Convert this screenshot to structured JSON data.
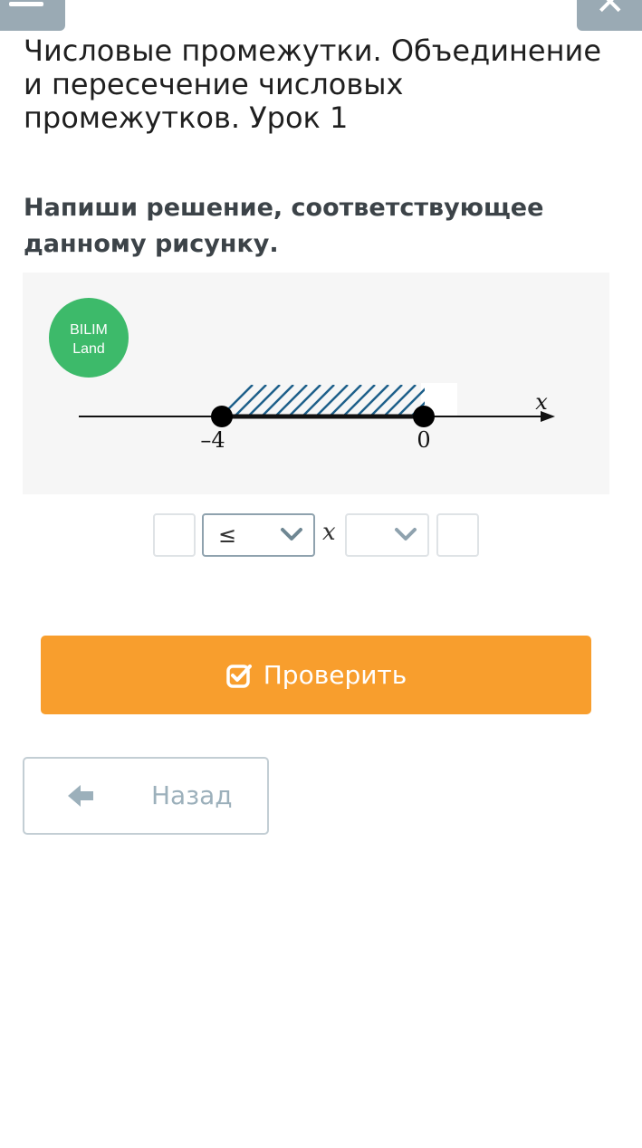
{
  "header": {
    "lesson_title": "Числовые промежутки. Объединение и пересечение числовых промежутков. Урок 1",
    "menu_icon": "menu-icon",
    "close_icon": "close-icon"
  },
  "task": {
    "instruction": "Напиши решение, соответствующее данному рисунку."
  },
  "figure": {
    "logo_line1": "BILIM",
    "logo_line2": "Land",
    "axis_variable": "x",
    "left_point_label": "–4",
    "right_point_label": "0",
    "left_point_value": -4,
    "right_point_value": 0,
    "left_point_filled": true,
    "right_point_filled": true,
    "logo_color": "#3dba6a",
    "hatch_color": "#1d5f8a"
  },
  "answer": {
    "left_value": "",
    "left_operator": "≤",
    "variable": "x",
    "right_operator": "",
    "right_value": ""
  },
  "buttons": {
    "check_label": "Проверить",
    "check_icon": "checkbox-check-icon",
    "back_label": "Назад",
    "back_icon": "arrow-left-icon"
  },
  "colors": {
    "accent": "#f89e2d",
    "muted": "#9aaab4"
  }
}
